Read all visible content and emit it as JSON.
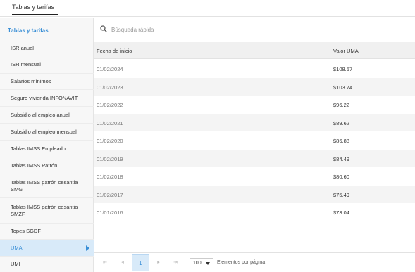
{
  "header": {
    "tab_label": "Tablas y tarifas"
  },
  "sidebar": {
    "title": "Tablas y tarifas",
    "items": [
      {
        "label": "ISR anual"
      },
      {
        "label": "ISR mensual"
      },
      {
        "label": "Salarios mínimos"
      },
      {
        "label": "Seguro vivienda INFONAVIT"
      },
      {
        "label": "Subsidio al empleo anual"
      },
      {
        "label": "Subsidio al empleo mensual"
      },
      {
        "label": "Tablas IMSS Empleado"
      },
      {
        "label": "Tablas IMSS Patrón"
      },
      {
        "label": "Tablas IMSS patrón cesantia SMG"
      },
      {
        "label": "Tablas IMSS patrón cesantia SMZF"
      },
      {
        "label": "Topes SGDF"
      },
      {
        "label": "UMA"
      },
      {
        "label": "UMI"
      }
    ],
    "active_item": "UMA"
  },
  "search": {
    "placeholder": "Búsqueda rápida",
    "value": ""
  },
  "table": {
    "columns": [
      "Fecha de inicio",
      "Valor UMA"
    ],
    "rows": [
      [
        "01/02/2024",
        "$108.57"
      ],
      [
        "01/02/2023",
        "$103.74"
      ],
      [
        "01/02/2022",
        "$96.22"
      ],
      [
        "01/02/2021",
        "$89.62"
      ],
      [
        "01/02/2020",
        "$86.88"
      ],
      [
        "01/02/2019",
        "$84.49"
      ],
      [
        "01/02/2018",
        "$80.60"
      ],
      [
        "01/02/2017",
        "$75.49"
      ],
      [
        "01/01/2016",
        "$73.04"
      ]
    ]
  },
  "pagination": {
    "first": "⇤",
    "prev": "◂",
    "current_page": "1",
    "next": "▸",
    "last": "⇥",
    "page_size": "100",
    "page_size_label": "Elementos por página"
  },
  "colors": {
    "accent": "#3a8fd6",
    "active_bg": "#d8eaf9"
  },
  "icons": {
    "search": "search-icon",
    "dropdown": "caret-down-icon",
    "active_marker": "caret-right-icon"
  }
}
